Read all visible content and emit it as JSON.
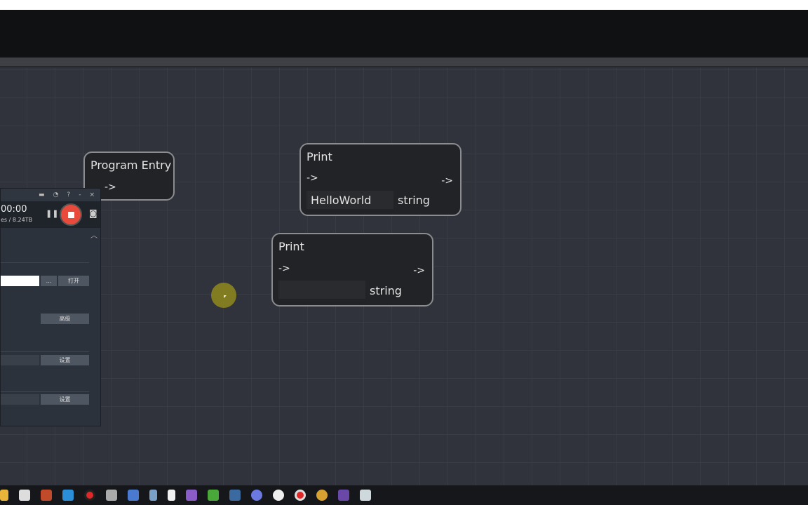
{
  "nodes": [
    {
      "title": "Program Entry",
      "out": "->"
    },
    {
      "title": "Print",
      "in": "->",
      "out": "->",
      "value": "HelloWorld",
      "type": "string"
    },
    {
      "title": "Print",
      "in": "->",
      "out": "->",
      "value": "",
      "type": "string"
    }
  ],
  "recorder": {
    "time": "00:00",
    "size": "es / 8.24TB",
    "title_icons": [
      "folder-icon",
      "clock-icon",
      "?",
      "-",
      "×"
    ],
    "browse": "...",
    "open": "打开",
    "advanced": "高级",
    "set1": "设置",
    "set2": "设置"
  },
  "taskbar": [
    "file-explorer",
    "store",
    "app",
    "mail",
    "recorder",
    "app",
    "network",
    "calculator",
    "notepad",
    "visual-studio",
    "minecraft",
    "steam",
    "discord",
    "app",
    "recorder-active",
    "chrome",
    "terminal",
    "app"
  ]
}
